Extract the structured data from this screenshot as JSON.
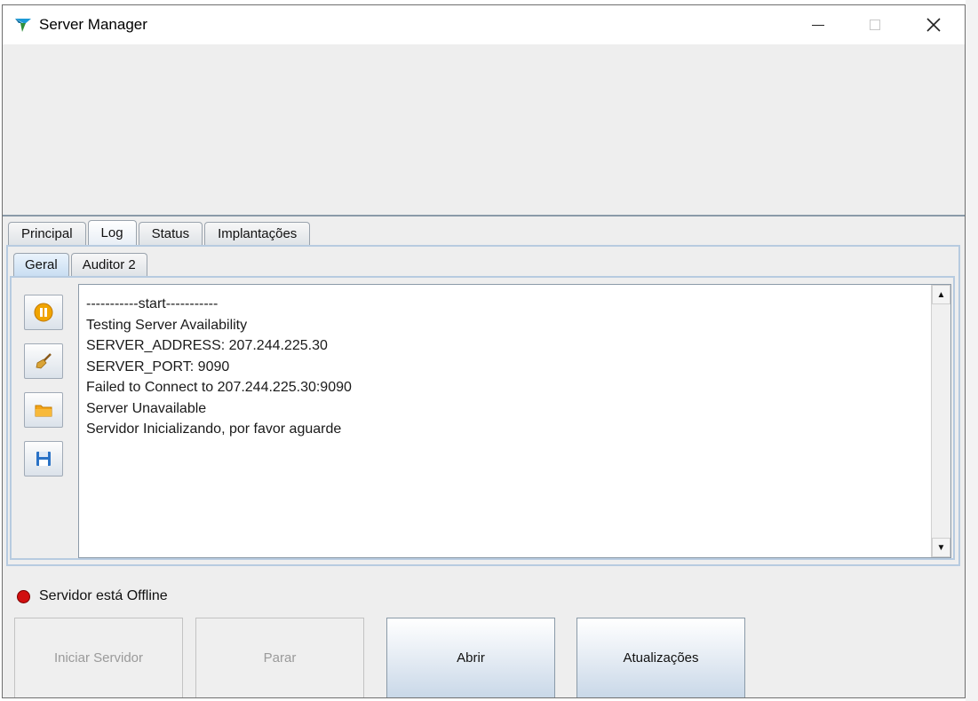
{
  "window": {
    "title": "Server Manager"
  },
  "tabs": [
    {
      "label": "Principal",
      "active": false
    },
    {
      "label": "Log",
      "active": true
    },
    {
      "label": "Status",
      "active": false
    },
    {
      "label": "Implantações",
      "active": false
    }
  ],
  "subtabs": [
    {
      "label": "Geral",
      "active": true
    },
    {
      "label": "Auditor 2",
      "active": false
    }
  ],
  "toolbar": {
    "icons": [
      "pause-icon",
      "broom-icon",
      "folder-icon",
      "save-icon"
    ]
  },
  "log": {
    "lines": [
      "-----------start-----------",
      "Testing Server Availability",
      "SERVER_ADDRESS: 207.244.225.30",
      "SERVER_PORT: 9090",
      "Failed to Connect to 207.244.225.30:9090",
      "Server Unavailable",
      "Servidor Inicializando, por favor aguarde"
    ]
  },
  "status": {
    "text": "Servidor está Offline",
    "color": "#d10f0f"
  },
  "buttons": {
    "start": "Iniciar Servidor",
    "stop": "Parar",
    "open": "Abrir",
    "updates": "Atualizações"
  },
  "colors": {
    "accent_border": "#b7cbe0",
    "window_bg": "#eeeeee"
  }
}
